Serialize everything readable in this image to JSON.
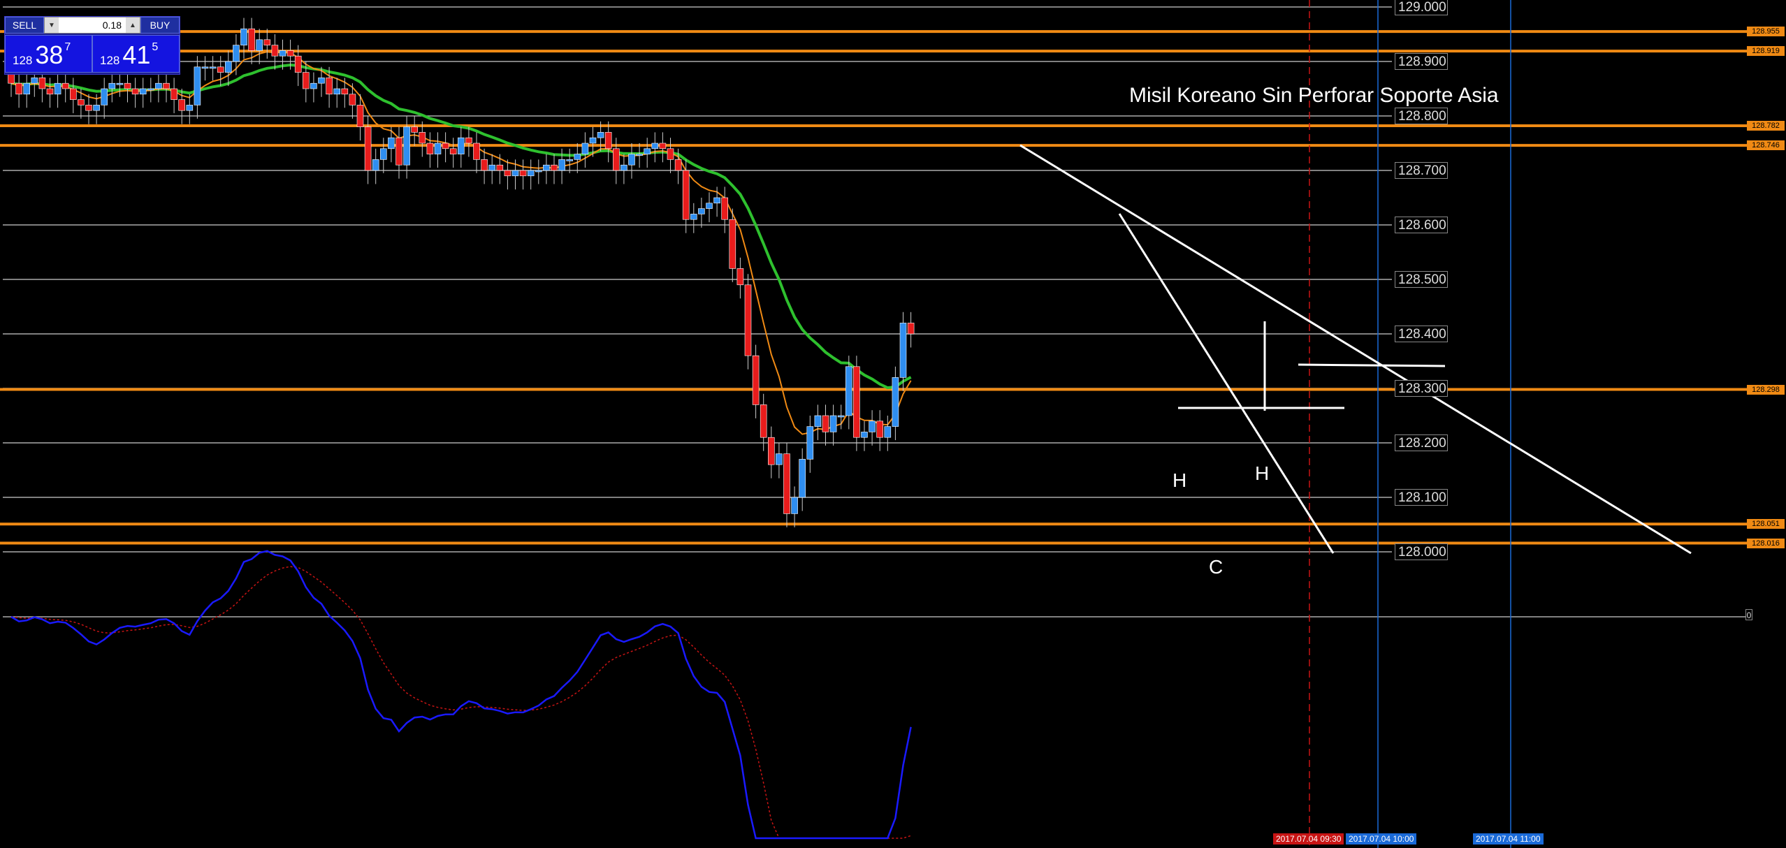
{
  "trade_panel": {
    "sell_label": "SELL",
    "buy_label": "BUY",
    "lot_value": "0.18",
    "sell_price": {
      "prefix": "128",
      "main": "38",
      "sup": "7"
    },
    "buy_price": {
      "prefix": "128",
      "main": "41",
      "sup": "5"
    }
  },
  "annotation": "Misil Koreano Sin Perforar Soporte Asia",
  "pattern_labels": {
    "left_shoulder": "H",
    "right_shoulder": "H",
    "head": "C"
  },
  "price_axis": [
    "129.000",
    "128.900",
    "128.800",
    "128.700",
    "128.600",
    "128.500",
    "128.400",
    "128.300",
    "128.200",
    "128.100",
    "128.000"
  ],
  "level_tags": [
    "128.955",
    "128.919",
    "128.782",
    "128.746",
    "128.298",
    "128.051",
    "128.016"
  ],
  "indicator_zero_label": "0",
  "time_labels": {
    "red": "2017.07.04 09:30",
    "blue1": "2017.07.04 10:00",
    "blue2": "2017.07.04 11:00"
  },
  "colors": {
    "background": "#000000",
    "bull_candle": "#2f8ef0",
    "bear_candle": "#e81c1c",
    "level_line": "#f08a14",
    "ma_slow": "#2ec02e",
    "ma_fast": "#f08a14",
    "oscillator_main": "#1a1aff",
    "oscillator_signal": "#c81414",
    "trend_lines": "#ffffff"
  },
  "chart_data": {
    "type": "candlestick",
    "symbol_unit": "USDJPY-style quote",
    "ylim": [
      128.0,
      129.0
    ],
    "levels": [
      128.955,
      128.919,
      128.782,
      128.746,
      128.298,
      128.051,
      128.016
    ],
    "candles": [
      [
        128.88,
        128.86
      ],
      [
        128.86,
        128.84
      ],
      [
        128.84,
        128.86
      ],
      [
        128.86,
        128.87
      ],
      [
        128.87,
        128.85
      ],
      [
        128.85,
        128.84
      ],
      [
        128.84,
        128.86
      ],
      [
        128.86,
        128.85
      ],
      [
        128.85,
        128.83
      ],
      [
        128.83,
        128.82
      ],
      [
        128.82,
        128.81
      ],
      [
        128.81,
        128.82
      ],
      [
        128.82,
        128.85
      ],
      [
        128.85,
        128.86
      ],
      [
        128.86,
        128.86
      ],
      [
        128.86,
        128.85
      ],
      [
        128.85,
        128.84
      ],
      [
        128.84,
        128.85
      ],
      [
        128.85,
        128.85
      ],
      [
        128.85,
        128.86
      ],
      [
        128.86,
        128.85
      ],
      [
        128.85,
        128.83
      ],
      [
        128.83,
        128.81
      ],
      [
        128.81,
        128.82
      ],
      [
        128.82,
        128.89
      ],
      [
        128.89,
        128.89
      ],
      [
        128.89,
        128.89
      ],
      [
        128.89,
        128.88
      ],
      [
        128.88,
        128.9
      ],
      [
        128.9,
        128.93
      ],
      [
        128.93,
        128.96
      ],
      [
        128.96,
        128.92
      ],
      [
        128.92,
        128.94
      ],
      [
        128.94,
        128.93
      ],
      [
        128.93,
        128.91
      ],
      [
        128.91,
        128.92
      ],
      [
        128.92,
        128.91
      ],
      [
        128.91,
        128.88
      ],
      [
        128.88,
        128.85
      ],
      [
        128.85,
        128.86
      ],
      [
        128.86,
        128.87
      ],
      [
        128.87,
        128.84
      ],
      [
        128.84,
        128.85
      ],
      [
        128.85,
        128.84
      ],
      [
        128.84,
        128.82
      ],
      [
        128.82,
        128.78
      ],
      [
        128.78,
        128.7
      ],
      [
        128.7,
        128.72
      ],
      [
        128.72,
        128.74
      ],
      [
        128.74,
        128.76
      ],
      [
        128.76,
        128.71
      ],
      [
        128.71,
        128.78
      ],
      [
        128.78,
        128.77
      ],
      [
        128.77,
        128.75
      ],
      [
        128.75,
        128.73
      ],
      [
        128.73,
        128.75
      ],
      [
        128.75,
        128.74
      ],
      [
        128.74,
        128.73
      ],
      [
        128.73,
        128.76
      ],
      [
        128.76,
        128.75
      ],
      [
        128.75,
        128.72
      ],
      [
        128.72,
        128.7
      ],
      [
        128.7,
        128.71
      ],
      [
        128.71,
        128.7
      ],
      [
        128.7,
        128.69
      ],
      [
        128.69,
        128.7
      ],
      [
        128.7,
        128.69
      ],
      [
        128.69,
        128.7
      ],
      [
        128.7,
        128.7
      ],
      [
        128.7,
        128.71
      ],
      [
        128.71,
        128.7
      ],
      [
        128.7,
        128.72
      ],
      [
        128.72,
        128.72
      ],
      [
        128.72,
        128.73
      ],
      [
        128.73,
        128.75
      ],
      [
        128.75,
        128.76
      ],
      [
        128.76,
        128.77
      ],
      [
        128.77,
        128.74
      ],
      [
        128.74,
        128.7
      ],
      [
        128.7,
        128.71
      ],
      [
        128.71,
        128.73
      ],
      [
        128.73,
        128.73
      ],
      [
        128.73,
        128.74
      ],
      [
        128.74,
        128.75
      ],
      [
        128.75,
        128.74
      ],
      [
        128.74,
        128.72
      ],
      [
        128.72,
        128.7
      ],
      [
        128.7,
        128.61
      ],
      [
        128.61,
        128.62
      ],
      [
        128.62,
        128.63
      ],
      [
        128.63,
        128.64
      ],
      [
        128.64,
        128.65
      ],
      [
        128.65,
        128.61
      ],
      [
        128.61,
        128.52
      ],
      [
        128.52,
        128.49
      ],
      [
        128.49,
        128.36
      ],
      [
        128.36,
        128.27
      ],
      [
        128.27,
        128.21
      ],
      [
        128.21,
        128.16
      ],
      [
        128.16,
        128.18
      ],
      [
        128.18,
        128.07
      ],
      [
        128.07,
        128.1
      ],
      [
        128.1,
        128.17
      ],
      [
        128.17,
        128.23
      ],
      [
        128.23,
        128.25
      ],
      [
        128.25,
        128.22
      ],
      [
        128.22,
        128.25
      ],
      [
        128.25,
        128.25
      ],
      [
        128.25,
        128.34
      ],
      [
        128.34,
        128.21
      ],
      [
        128.21,
        128.22
      ],
      [
        128.22,
        128.24
      ],
      [
        128.24,
        128.21
      ],
      [
        128.21,
        128.23
      ],
      [
        128.23,
        128.32
      ],
      [
        128.32,
        128.42
      ],
      [
        128.42,
        128.4
      ]
    ],
    "trend_lines": [
      {
        "name": "descending resistance",
        "from": [
          128.74,
          0
        ],
        "to": [
          128.0,
          1
        ]
      },
      {
        "name": "steep trendline",
        "from": [
          128.63,
          0
        ],
        "to": [
          128.0,
          1
        ]
      },
      {
        "name": "neckline",
        "value": 128.27
      },
      {
        "name": "upper neckline",
        "value": 128.345
      }
    ],
    "oscillator": {
      "zero_line": 0
    }
  }
}
